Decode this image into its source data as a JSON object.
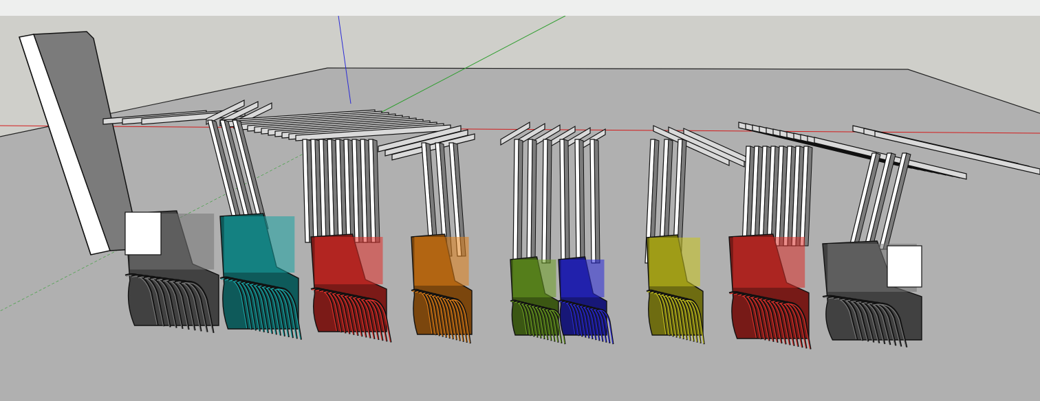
{
  "app": {
    "viewport_name": "3d-model-viewport"
  },
  "colors": {
    "toolbar_bg": "#eeefee",
    "sky": "#cfcfca",
    "ground": "#b0b0b0",
    "axis_red": "#d41a1a",
    "axis_green": "#2f9e2f",
    "axis_blue": "#2b2bd6",
    "panel_gray": "#777777",
    "panel_white": "#ffffff",
    "cyan": "#1aa3a3",
    "red": "#e0302a",
    "orange": "#e07f18",
    "green": "#6c9f23",
    "blue": "#2a2ad8",
    "yellow": "#c8c41e",
    "red2": "#d9302a"
  },
  "model": {
    "description_icon": "3d-axes-icon",
    "groups": [
      {
        "name": "left-panel",
        "color": "#777777"
      },
      {
        "name": "white-gray-block",
        "color": "#ffffff"
      },
      {
        "name": "cyan-block",
        "color": "#1aa3a3"
      },
      {
        "name": "red-block",
        "color": "#e0302a"
      },
      {
        "name": "orange-block",
        "color": "#e07f18"
      },
      {
        "name": "green-block",
        "color": "#6c9f23"
      },
      {
        "name": "blue-block",
        "color": "#2a2ad8"
      },
      {
        "name": "yellow-block",
        "color": "#c8c41e"
      },
      {
        "name": "red-block-2",
        "color": "#d9302a"
      },
      {
        "name": "right-gray-block",
        "color": "#777777"
      }
    ]
  }
}
